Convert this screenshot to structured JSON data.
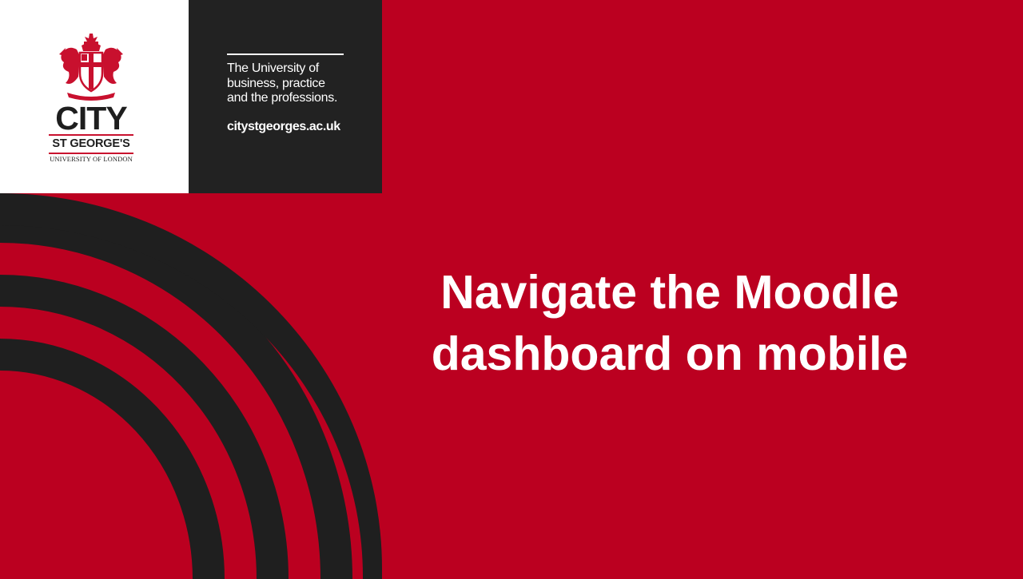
{
  "logo": {
    "wordmark": "CITY",
    "subwordmark": "ST GEORGE'S",
    "institution": "UNIVERSITY OF LONDON",
    "crest_icon": "coat-of-arms-icon"
  },
  "tagline": {
    "lines": [
      "The University of",
      "business, practice",
      "and the professions."
    ],
    "url": "citystgeorges.ac.uk"
  },
  "slide": {
    "title_lines": [
      "Navigate the Moodle",
      "dashboard on mobile"
    ]
  },
  "colors": {
    "brand_red": "#bb0020",
    "panel_dark": "#222222",
    "arc_dark": "#1f1f1f",
    "white": "#ffffff"
  }
}
